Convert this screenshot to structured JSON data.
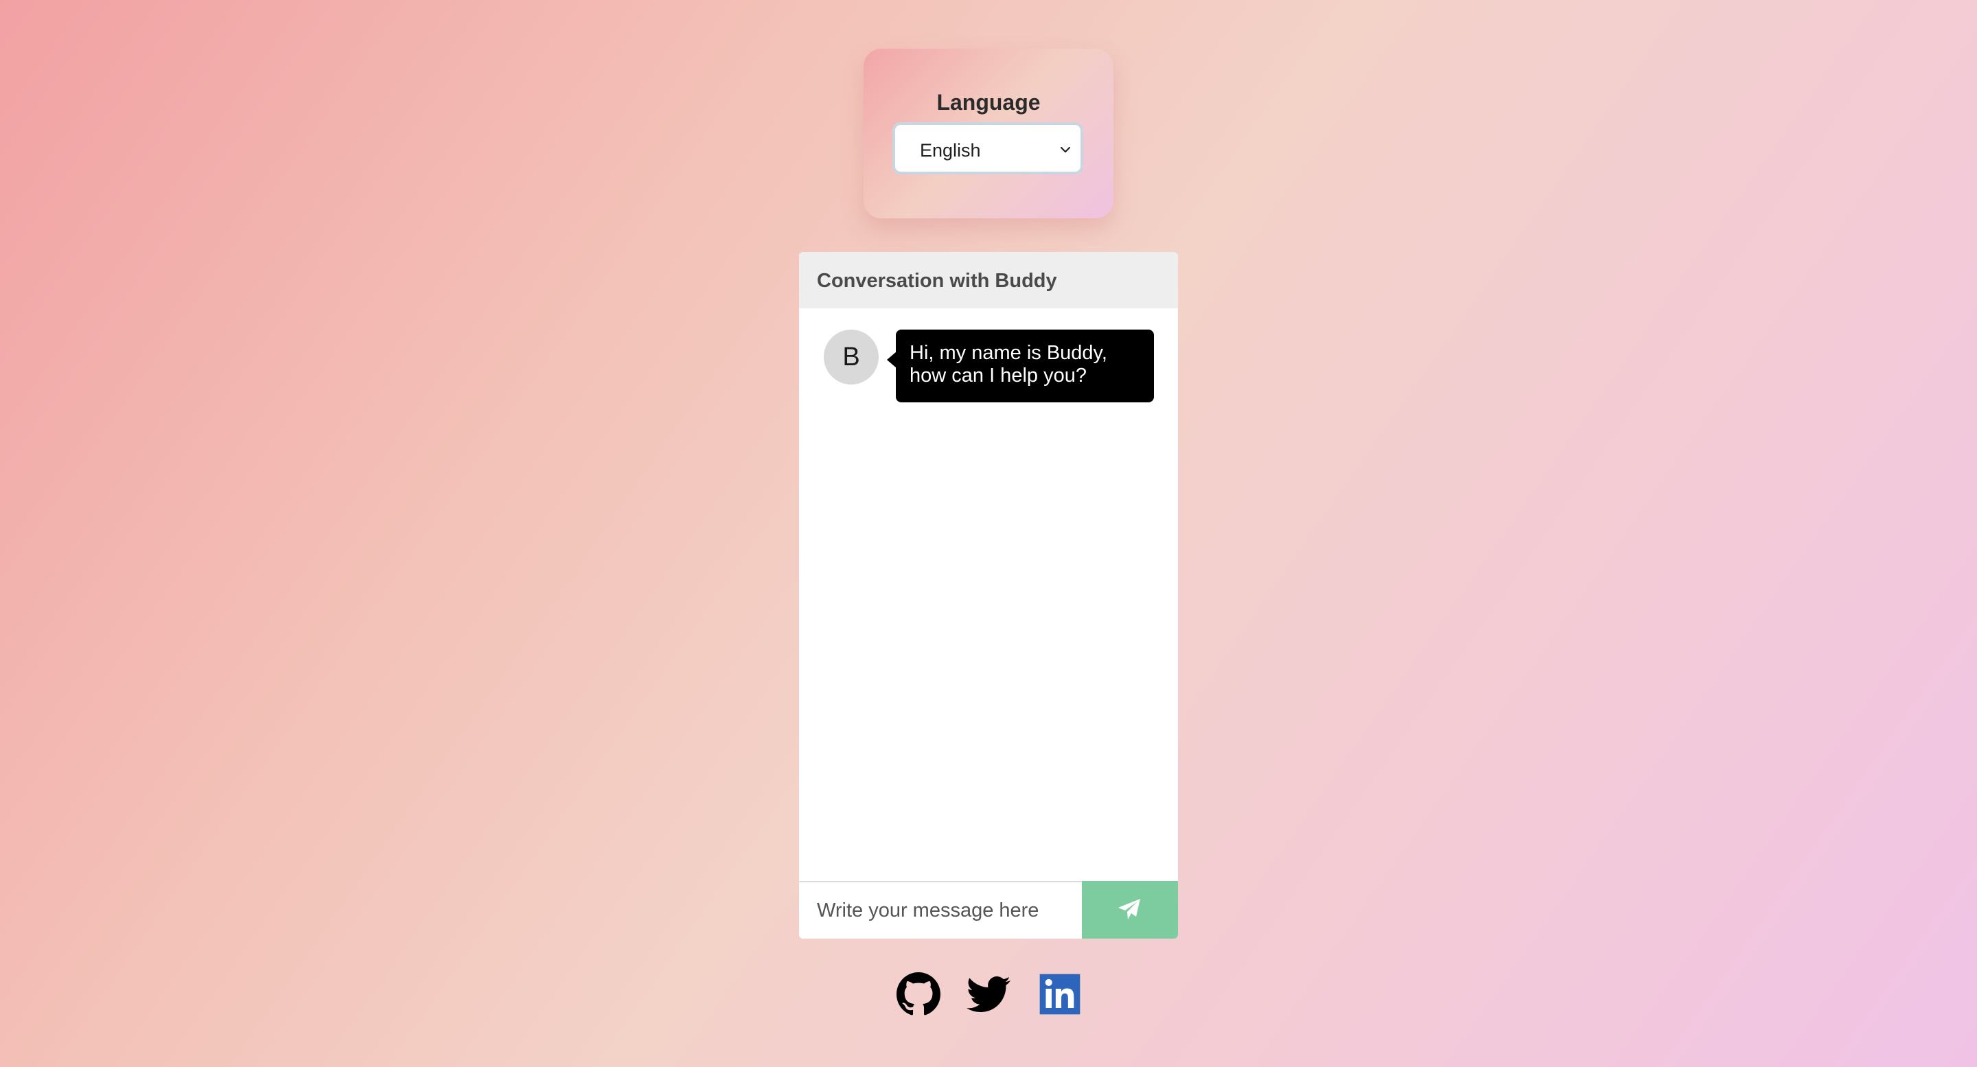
{
  "language_card": {
    "title": "Language",
    "selected_language": "English"
  },
  "chat": {
    "header_title": "Conversation with Buddy",
    "messages": [
      {
        "sender_initial": "B",
        "text": "Hi, my name is Buddy, how can I help you?"
      }
    ],
    "input_placeholder": "Write your message here",
    "send_icon": "paper-plane-icon"
  },
  "social_links": [
    {
      "icon": "github-icon",
      "color": "#000000"
    },
    {
      "icon": "twitter-icon",
      "color": "#000000"
    },
    {
      "icon": "linkedin-icon",
      "color": "#2d64bc"
    }
  ],
  "colors": {
    "send_button": "#7dcca0",
    "bubble_bg": "#000000",
    "header_bg": "#eeeeee",
    "avatar_bg": "#d9d9d9"
  }
}
